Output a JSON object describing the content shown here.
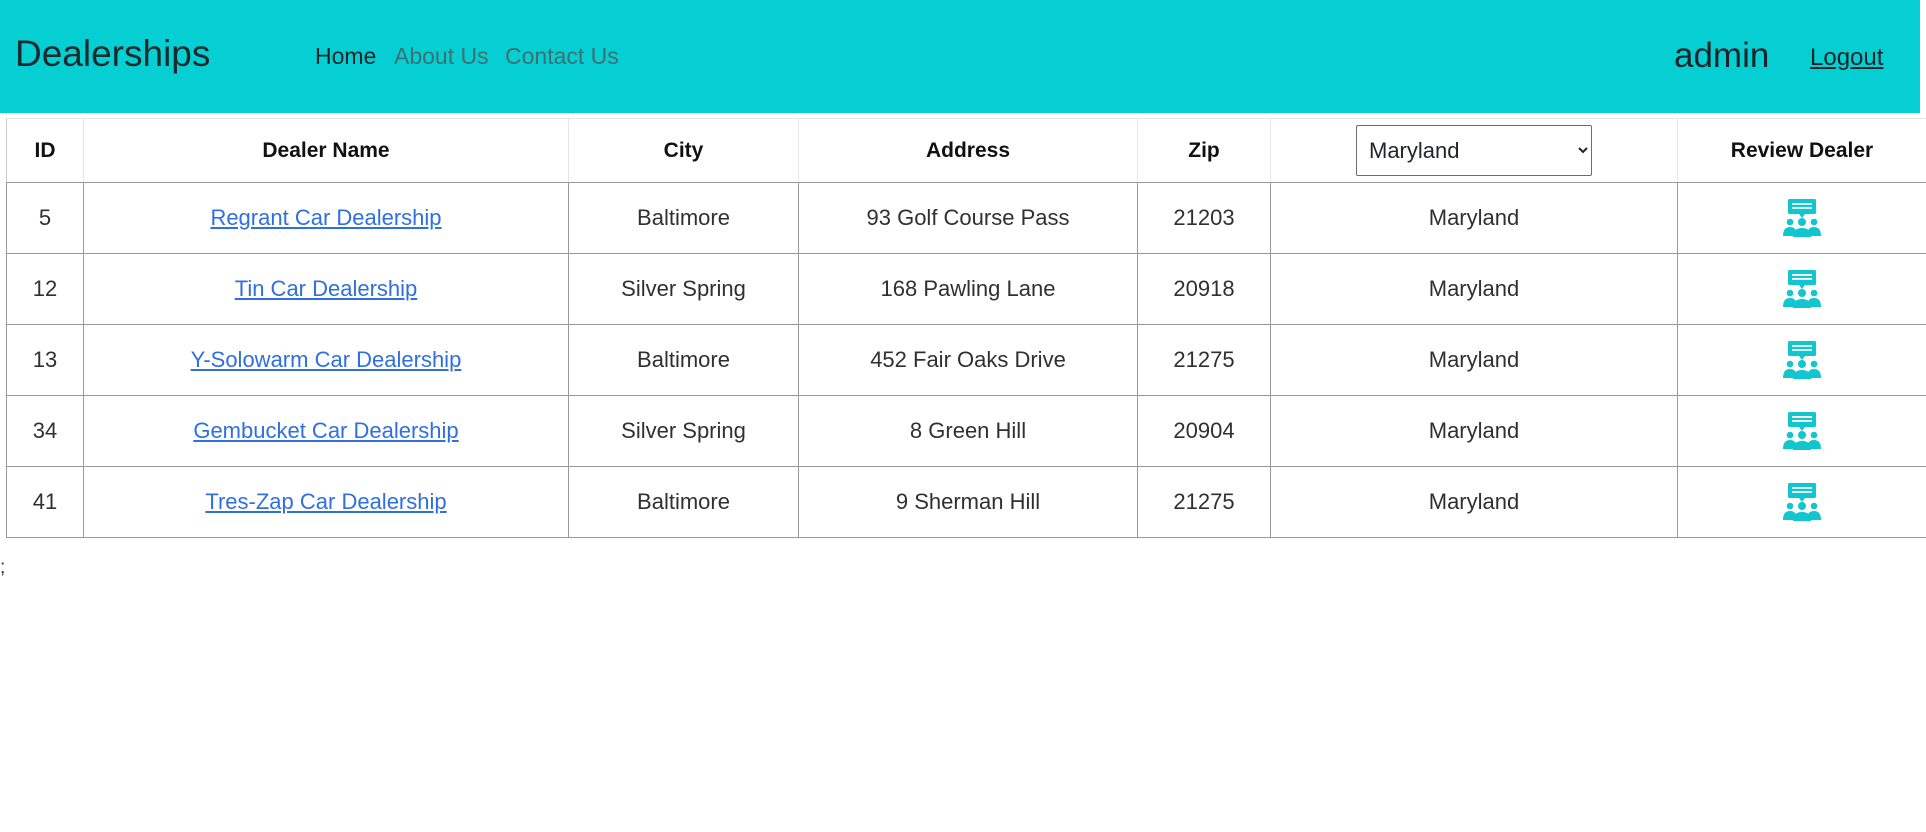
{
  "navbar": {
    "brand": "Dealerships",
    "links": [
      {
        "label": "Home"
      },
      {
        "label": "About Us"
      },
      {
        "label": "Contact Us"
      }
    ],
    "user": "admin",
    "logout_label": "Logout",
    "background": "#05cfd3"
  },
  "table": {
    "headers": {
      "id": "ID",
      "name": "Dealer Name",
      "city": "City",
      "address": "Address",
      "zip": "Zip",
      "review": "Review Dealer"
    },
    "state_filter": {
      "selected": "Maryland"
    },
    "rows": [
      {
        "id": "5",
        "name": "Regrant Car Dealership",
        "city": "Baltimore",
        "address": "93 Golf Course Pass",
        "zip": "21203",
        "state": "Maryland",
        "review_icon": "review-dealer-icon"
      },
      {
        "id": "12",
        "name": "Tin Car Dealership",
        "city": "Silver Spring",
        "address": "168 Pawling Lane",
        "zip": "20918",
        "state": "Maryland",
        "review_icon": "review-dealer-icon"
      },
      {
        "id": "13",
        "name": "Y-Solowarm Car Dealership",
        "city": "Baltimore",
        "address": "452 Fair Oaks Drive",
        "zip": "21275",
        "state": "Maryland",
        "review_icon": "review-dealer-icon"
      },
      {
        "id": "34",
        "name": "Gembucket Car Dealership",
        "city": "Silver Spring",
        "address": "8 Green Hill",
        "zip": "20904",
        "state": "Maryland",
        "review_icon": "review-dealer-icon"
      },
      {
        "id": "41",
        "name": "Tres-Zap Car Dealership",
        "city": "Baltimore",
        "address": "9 Sherman Hill",
        "zip": "21275",
        "state": "Maryland",
        "review_icon": "review-dealer-icon"
      }
    ]
  },
  "stray_text": ";",
  "colors": {
    "accent": "#05cfd3",
    "link": "#2f6fe0",
    "icon": "#12c6cf"
  }
}
